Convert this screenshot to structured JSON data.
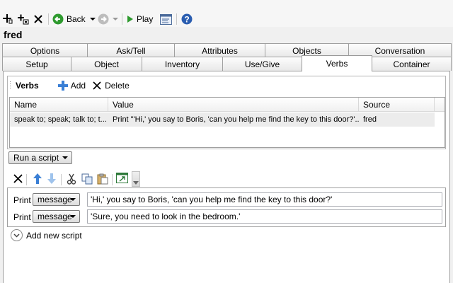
{
  "toolbar": {
    "back_label": "Back",
    "play_label": "Play"
  },
  "object_name": "fred",
  "tabs_row1": [
    "Options",
    "Ask/Tell",
    "Attributes",
    "Objects",
    "Conversation"
  ],
  "tabs_row2": [
    "Setup",
    "Object",
    "Inventory",
    "Use/Give",
    "Verbs",
    "Container"
  ],
  "active_tab": "Verbs",
  "verbs": {
    "title": "Verbs",
    "add_label": "Add",
    "delete_label": "Delete",
    "columns": [
      "Name",
      "Value",
      "Source"
    ],
    "rows": [
      {
        "name": "speak to; speak; talk to; t...",
        "value": "Print \"'Hi,' you say to Boris, 'can you help me find the key to this door?'...",
        "source": "fred"
      }
    ]
  },
  "run_script": {
    "selected": "Run a script"
  },
  "script": {
    "lines": [
      {
        "command": "Print",
        "type": "message",
        "text": "'Hi,' you say to Boris, 'can you help me find the key to this door?'"
      },
      {
        "command": "Print",
        "type": "message",
        "text": "'Sure, you need to look in the bedroom.'"
      }
    ],
    "add_new_label": "Add new script"
  },
  "colors": {
    "accent_green": "#2e9a2e",
    "help_blue": "#2a5db0",
    "arrow_blue": "#3a7fd5"
  }
}
